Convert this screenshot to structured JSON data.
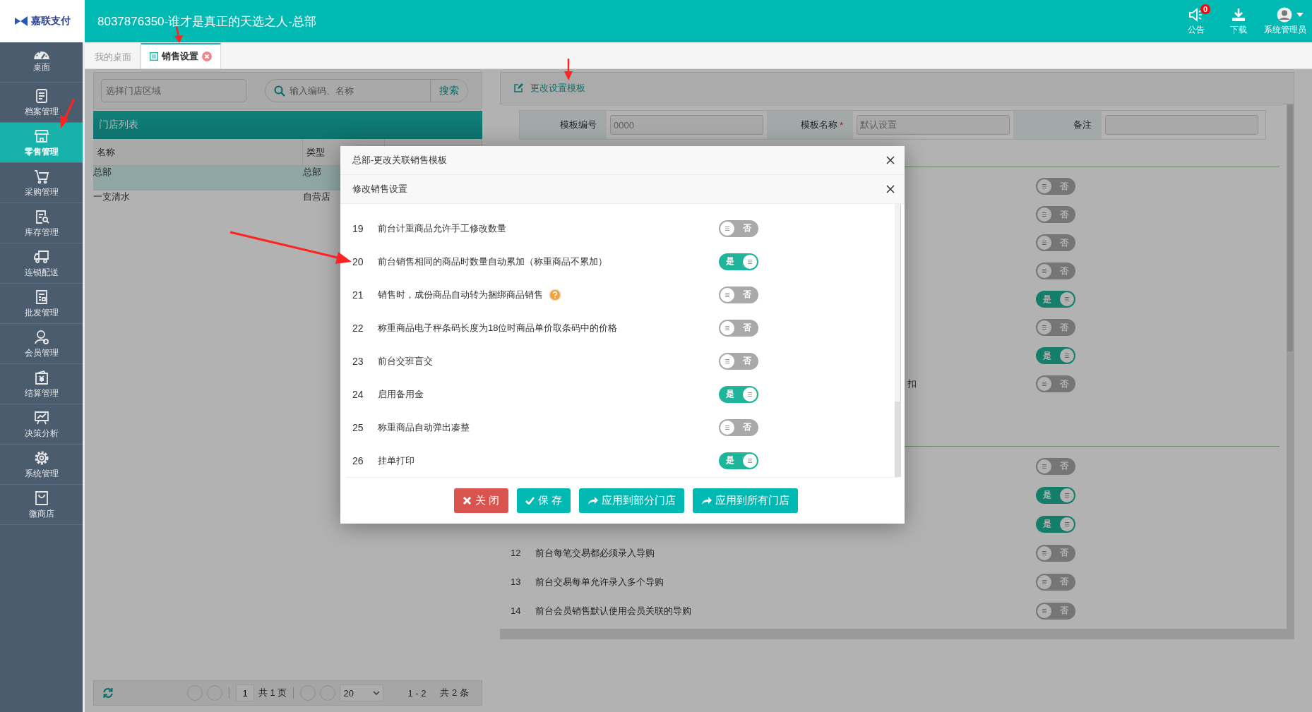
{
  "logo": {
    "text": "嘉联支付"
  },
  "header": {
    "title": "8037876350-谁才是真正的天选之人-总部",
    "actions": [
      {
        "kind": "notice",
        "label": "公告",
        "badge": "0"
      },
      {
        "kind": "download",
        "label": "下载"
      },
      {
        "kind": "user",
        "label": "系统管理员"
      }
    ]
  },
  "sidebar": {
    "items": [
      {
        "label": "桌面",
        "selected": false
      },
      {
        "label": "档案管理",
        "selected": false
      },
      {
        "label": "零售管理",
        "selected": true
      },
      {
        "label": "采购管理",
        "selected": false
      },
      {
        "label": "库存管理",
        "selected": false
      },
      {
        "label": "连锁配送",
        "selected": false
      },
      {
        "label": "批发管理",
        "selected": false
      },
      {
        "label": "会员管理",
        "selected": false
      },
      {
        "label": "结算管理",
        "selected": false
      },
      {
        "label": "决策分析",
        "selected": false
      },
      {
        "label": "系统管理",
        "selected": false
      },
      {
        "label": "微商店",
        "selected": false
      }
    ]
  },
  "tabs": [
    {
      "label": "我的桌面",
      "selected": false,
      "closable": false
    },
    {
      "label": "销售设置",
      "selected": true,
      "closable": true
    }
  ],
  "store_panel": {
    "region_field": {
      "placeholder": "选择门店区域"
    },
    "search": {
      "placeholder": "输入编码、名称",
      "button": "搜索"
    },
    "title": "门店列表",
    "columns": [
      "名称",
      "类型"
    ],
    "rows": [
      {
        "cells": [
          "总部",
          "总部"
        ],
        "selected": true
      },
      {
        "cells": [
          "一支清水",
          "自营店"
        ],
        "selected": false
      }
    ],
    "pager": {
      "page": "1",
      "pages": "共 1 页",
      "page_size": "20",
      "range": "1 - 2",
      "total": "共 2 条"
    }
  },
  "template_panel": {
    "action": "更改设置模板",
    "fields": [
      {
        "label": "模板编号",
        "value": "0000"
      },
      {
        "label": "模板名称",
        "mark": "*",
        "value": "默认设置"
      },
      {
        "label": "备注"
      }
    ],
    "sections": [
      {
        "rows": [
          {
            "on": false,
            "switch_text": "否"
          },
          {
            "on": false,
            "switch_text": "否"
          },
          {
            "on": false,
            "switch_text": "否"
          },
          {
            "on": false,
            "switch_text": "否"
          },
          {
            "on": true,
            "switch_text": "是"
          },
          {
            "on": false,
            "switch_text": "否"
          },
          {
            "on": true,
            "switch_text": "是"
          },
          {
            "kind": "tail",
            "label": "扣",
            "on": false,
            "switch_text": "否"
          }
        ]
      },
      {
        "rows": [
          {
            "on": false,
            "switch_text": "否"
          },
          {
            "on": true,
            "switch_text": "是"
          },
          {
            "on": true,
            "switch_text": "是"
          },
          {
            "number": "12",
            "label": "前台每笔交易都必须录入导购",
            "on": false,
            "switch_text": "否"
          },
          {
            "number": "13",
            "label": "前台交易每单允许录入多个导购",
            "on": false,
            "switch_text": "否"
          },
          {
            "number": "14",
            "label": "前台会员销售默认使用会员关联的导购",
            "on": false,
            "switch_text": "否"
          }
        ]
      }
    ]
  },
  "modal": {
    "title": "总部-更改关联销售模板",
    "subtitle": "修改销售设置",
    "settings": [
      {
        "number": "19",
        "label": "前台计重商品允许手工修改数量",
        "on": false,
        "switch_text": "否",
        "kind": "plain"
      },
      {
        "number": "20",
        "label": "前台销售相同的商品时数量自动累加（称重商品不累加）",
        "on": true,
        "switch_text": "是",
        "kind": "plain"
      },
      {
        "number": "21",
        "label": "销售时，成份商品自动转为捆绑商品销售",
        "on": false,
        "switch_text": "否",
        "kind": "help"
      },
      {
        "number": "22",
        "label": "称重商品电子秤条码长度为18位时商品单价取条码中的价格",
        "on": false,
        "switch_text": "否",
        "kind": "plain"
      },
      {
        "number": "23",
        "label": "前台交班盲交",
        "on": false,
        "switch_text": "否",
        "kind": "plain"
      },
      {
        "number": "24",
        "label": "启用备用金",
        "on": true,
        "switch_text": "是",
        "kind": "plain"
      },
      {
        "number": "25",
        "label": "称重商品自动弹出凑整",
        "on": false,
        "switch_text": "否",
        "kind": "plain"
      },
      {
        "number": "26",
        "label": "挂单打印",
        "on": true,
        "switch_text": "是",
        "kind": "plain"
      }
    ],
    "buttons": [
      {
        "kind": "close",
        "label": "关 闭"
      },
      {
        "kind": "save",
        "label": "保 存"
      },
      {
        "kind": "apply",
        "label": "应用到部分门店"
      },
      {
        "kind": "apply",
        "label": "应用到所有门店"
      }
    ]
  }
}
